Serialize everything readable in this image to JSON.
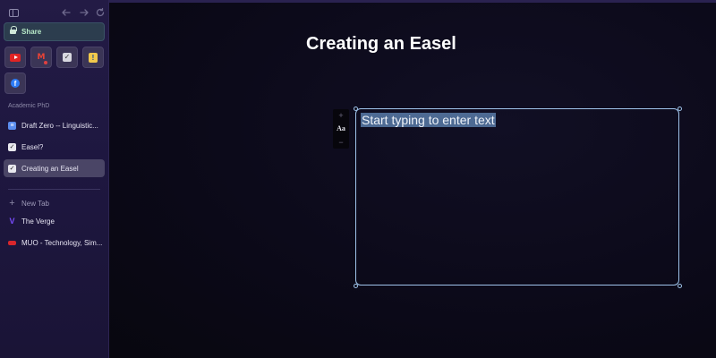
{
  "sidebar": {
    "share_label": "Share",
    "favorites": [
      {
        "icon": "youtube-icon"
      },
      {
        "icon": "gmail-icon",
        "glyph": "M"
      },
      {
        "icon": "checkbox-icon",
        "glyph": "✓"
      },
      {
        "icon": "bitwarden-icon",
        "glyph": "!"
      },
      {
        "icon": "facebook-icon",
        "glyph": "f"
      }
    ],
    "section_title": "Academic PhD",
    "tabs": [
      {
        "label": "Draft Zero -- Linguistic...",
        "icon": "document-icon",
        "glyph": "≡",
        "active": false
      },
      {
        "label": "Easel?",
        "icon": "checkbox-icon",
        "glyph": "✓",
        "active": false
      },
      {
        "label": "Creating an Easel",
        "icon": "checkbox-icon",
        "glyph": "✓",
        "active": true
      }
    ],
    "new_tab_label": "New Tab",
    "pinned_tabs": [
      {
        "label": "The Verge",
        "icon": "verge-icon",
        "glyph": "V"
      },
      {
        "label": "MUO - Technology, Sim...",
        "icon": "muo-icon",
        "glyph": ""
      }
    ]
  },
  "canvas": {
    "title": "Creating an Easel",
    "text_box": {
      "placeholder": "Start typing to enter text"
    },
    "toolbar": {
      "increase_glyph": "+",
      "font_glyph": "Aa",
      "decrease_glyph": "−"
    }
  },
  "colors": {
    "sidebar_bg": "#1e1740",
    "canvas_bg": "#0b0918",
    "share_accent": "#b7e8c7",
    "selection_border": "#9fc3ea",
    "text_highlight": "#4d6a93"
  }
}
